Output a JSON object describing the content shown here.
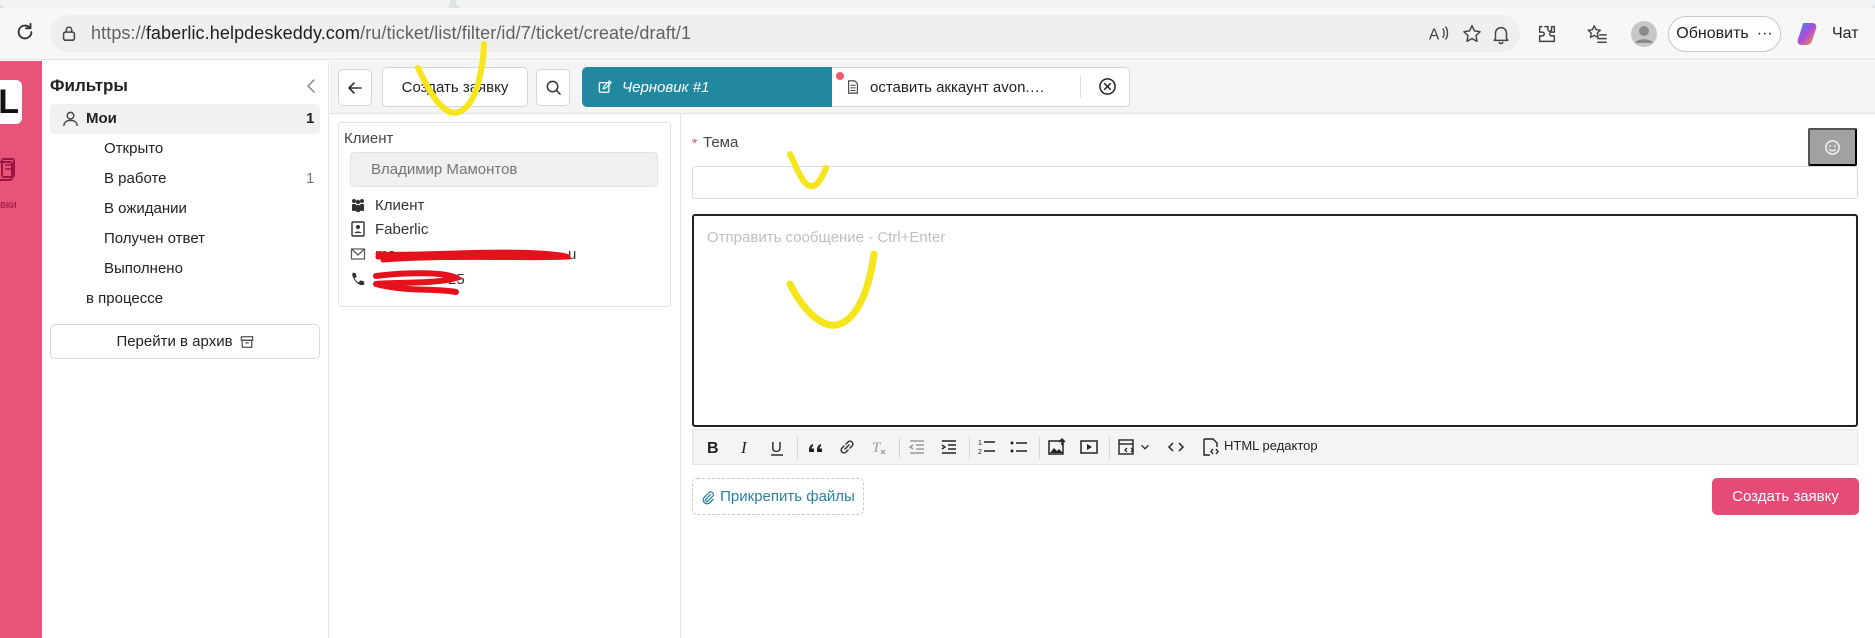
{
  "browser": {
    "url_prefix": "https://",
    "url_host": "faberlic.helpdeskeddy.com",
    "url_path": "/ru/ticket/list/filter/id/7/ticket/create/draft/1",
    "update_label": "Обновить",
    "update_more": "···",
    "chat_label": "Чат"
  },
  "rail": {
    "logo_text": "L",
    "item_label": "явки"
  },
  "filters": {
    "title": "Фильтры",
    "mine": {
      "label": "Мои",
      "count": "1"
    },
    "items": [
      {
        "label": "Открыто",
        "count": ""
      },
      {
        "label": "В работе",
        "count": "1"
      },
      {
        "label": "В ожидании",
        "count": ""
      },
      {
        "label": "Получен ответ",
        "count": ""
      },
      {
        "label": "Выполнено",
        "count": ""
      }
    ],
    "in_progress": "в процессе",
    "archive_label": "Перейти в архив"
  },
  "toolbar": {
    "create_label": "Создать заявку",
    "tabs": [
      {
        "label": "Черновик #1",
        "active": true
      },
      {
        "label": "оставить аккаунт avon.…",
        "active": false
      }
    ]
  },
  "client": {
    "title": "Клиент",
    "name_placeholder": "Владимир Мамонтов",
    "role": "Клиент",
    "company": "Faberlic",
    "email_visible_start": "ma",
    "email_visible_end": "u",
    "phone_visible_end": "25"
  },
  "form": {
    "subject_required": "*",
    "subject_label": "Тема",
    "message_placeholder": "Отправить сообщение - Ctrl+Enter",
    "html_editor_label": "HTML редактор",
    "attach_label": "Прикрепить файлы",
    "submit_label": "Создать заявку"
  },
  "colors": {
    "rail": "#e8537a",
    "active_tab": "#22889f",
    "submit": "#e64b78",
    "annotation_yellow": "#f6e51a",
    "redaction_red": "#e4121c"
  }
}
